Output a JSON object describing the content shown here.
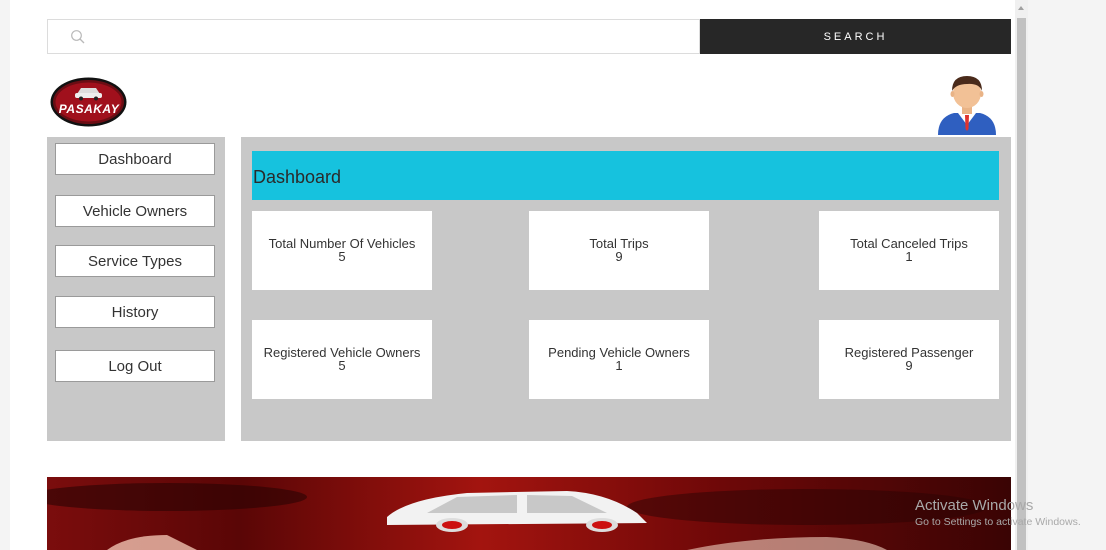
{
  "search": {
    "placeholder": "",
    "button_label": "SEARCH"
  },
  "logo": {
    "text": "PASAKAY"
  },
  "sidebar": {
    "items": [
      {
        "label": "Dashboard"
      },
      {
        "label": "Vehicle Owners"
      },
      {
        "label": "Service Types"
      },
      {
        "label": "History"
      },
      {
        "label": "Log Out"
      }
    ]
  },
  "main": {
    "title": "Dashboard",
    "cards": [
      {
        "label": "Total Number Of Vehicles",
        "value": "5"
      },
      {
        "label": "Total Trips",
        "value": "9"
      },
      {
        "label": "Total Canceled Trips",
        "value": "1"
      },
      {
        "label": "Registered Vehicle Owners",
        "value": "5"
      },
      {
        "label": "Pending Vehicle Owners",
        "value": "1"
      },
      {
        "label": "Registered Passenger",
        "value": "9"
      }
    ]
  },
  "watermark": {
    "title": "Activate Windows",
    "subtitle": "Go to Settings to activate Windows."
  },
  "colors": {
    "header_bar": "#16c2de",
    "search_button": "#272727",
    "panel_bg": "#c8c8c8",
    "logo_bg": "#6b0d14"
  }
}
